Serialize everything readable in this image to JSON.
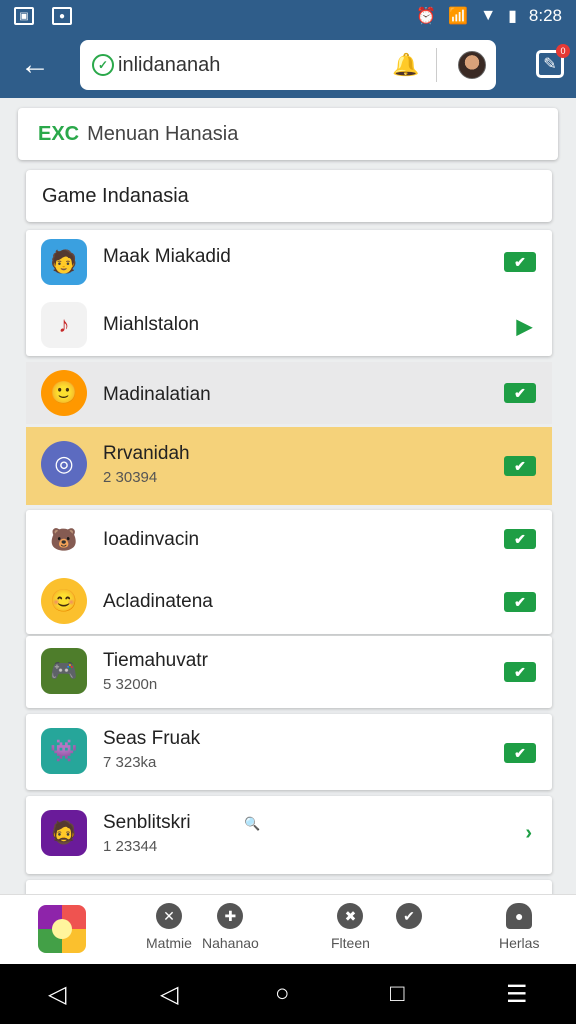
{
  "status_bar": {
    "time": "8:28"
  },
  "app_bar": {
    "search_value": "inlidananah"
  },
  "header": {
    "tag": "EXC",
    "title": "Menuan Hanasia"
  },
  "section_title": "Game Indanasia",
  "rows": [
    {
      "name": "Maak Miakadid",
      "sub": ""
    },
    {
      "name": "Miahlstalon",
      "sub": ""
    },
    {
      "name": "Madinalatian",
      "sub": ""
    },
    {
      "name": "Rrvanidah",
      "sub": "2 30394"
    },
    {
      "name": "Ioadinvacin",
      "sub": ""
    },
    {
      "name": "Acladinatena",
      "sub": ""
    },
    {
      "name": "Tiemahuvatr",
      "sub": "5 3200n"
    },
    {
      "name": "Seas Fruak",
      "sub": "7 323ka"
    },
    {
      "name": "Senblitskri",
      "sub": "1 23344"
    }
  ],
  "bottom_nav": {
    "items": [
      "Matmie",
      "Nahanao",
      "Flteen",
      "Herlas"
    ]
  },
  "colors": {
    "primary": "#2f5d8a",
    "accent_green": "#1e9e45",
    "highlight": "#f5d27a"
  }
}
